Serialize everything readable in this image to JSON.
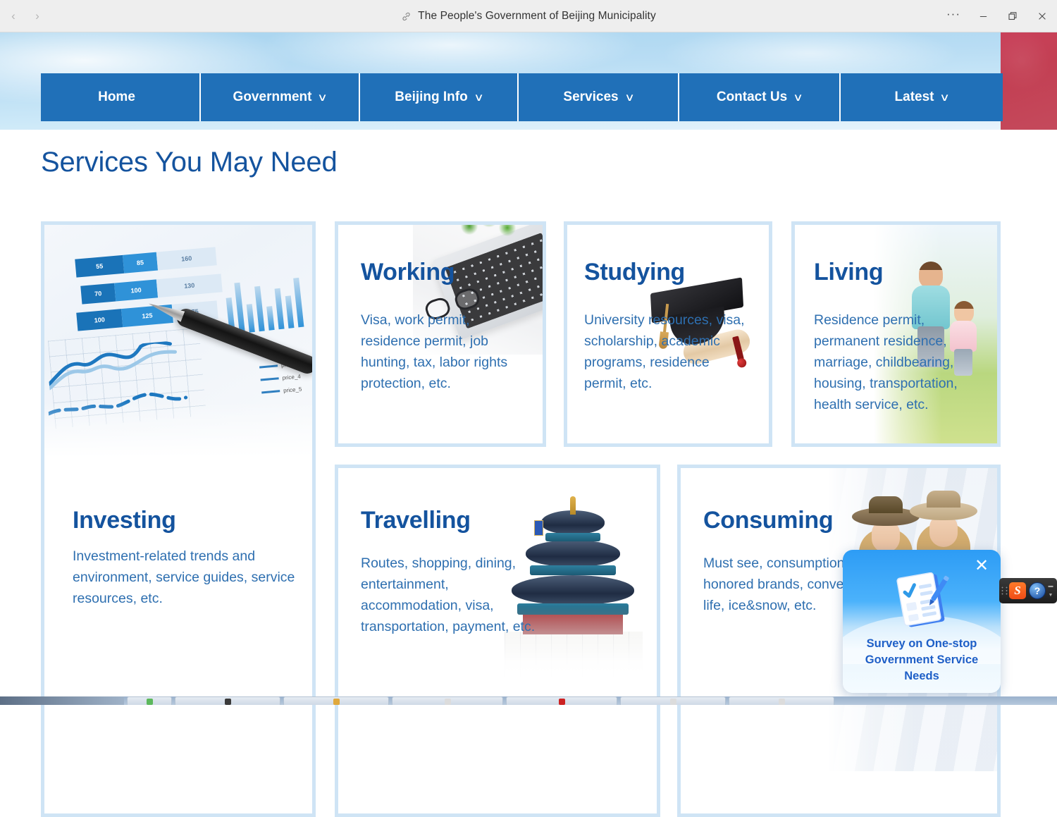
{
  "browser": {
    "title": "The People's Government of Beijing Municipality",
    "link_icon": "link-icon",
    "back_label": "‹",
    "forward_label": "›",
    "more_label": "···",
    "minimize_label": "─",
    "restore_label": "❐",
    "close_label": "✕"
  },
  "nav": {
    "items": [
      {
        "label": "Home",
        "caret": ""
      },
      {
        "label": "Government",
        "caret": "∨"
      },
      {
        "label": "Beijing Info",
        "caret": "∨"
      },
      {
        "label": "Services",
        "caret": "∨"
      },
      {
        "label": "Contact Us",
        "caret": "∨"
      },
      {
        "label": "Latest",
        "caret": "∨"
      }
    ]
  },
  "page": {
    "section_title": "Services You May Need"
  },
  "cards": [
    {
      "key": "investing",
      "title": "Investing",
      "body": "Investment-related trends and environment, service guides, service resources, etc.",
      "image": "financial-charts-and-pen-photo"
    },
    {
      "key": "working",
      "title": "Working",
      "body": "Visa, work permit, residence permit, job hunting, tax, labor rights protection, etc.",
      "image": "laptop-glasses-and-plant-photo"
    },
    {
      "key": "studying",
      "title": "Studying",
      "body": "University resources, visa, scholarship, academic programs, residence permit, etc.",
      "image": "graduation-cap-and-diploma-photo"
    },
    {
      "key": "living",
      "title": "Living",
      "body": "Residence permit, permanent residence, marriage, childbearing, housing, transportation, health service, etc.",
      "image": "father-and-daughter-outdoors-photo"
    },
    {
      "key": "travelling",
      "title": "Travelling",
      "body": "Routes, shopping, dining, entertainment, accommodation,  visa, transportation, payment, etc.",
      "image": "temple-of-heaven-photo"
    },
    {
      "key": "consuming",
      "title": "Consuming",
      "body": "Must see, consumption seasons, time-honored brands, conventions, smart life, ice&snow, etc.",
      "image": "two-women-in-hats-shopping-photo"
    }
  ],
  "survey_popup": {
    "text": "Survey on One-stop Government Service Needs",
    "close_label": "✕",
    "icon": "survey-clipboard-icon"
  },
  "ime_toolbar": {
    "sogou_label": "S",
    "help_label": "?",
    "collapse_label": "▬",
    "expand_label": "▼"
  },
  "colors": {
    "nav_blue": "#2070b8",
    "heading_blue": "#14539e",
    "body_blue": "#2e6fb0",
    "card_border": "#cfe4f5",
    "banner_red": "#c33f53"
  }
}
